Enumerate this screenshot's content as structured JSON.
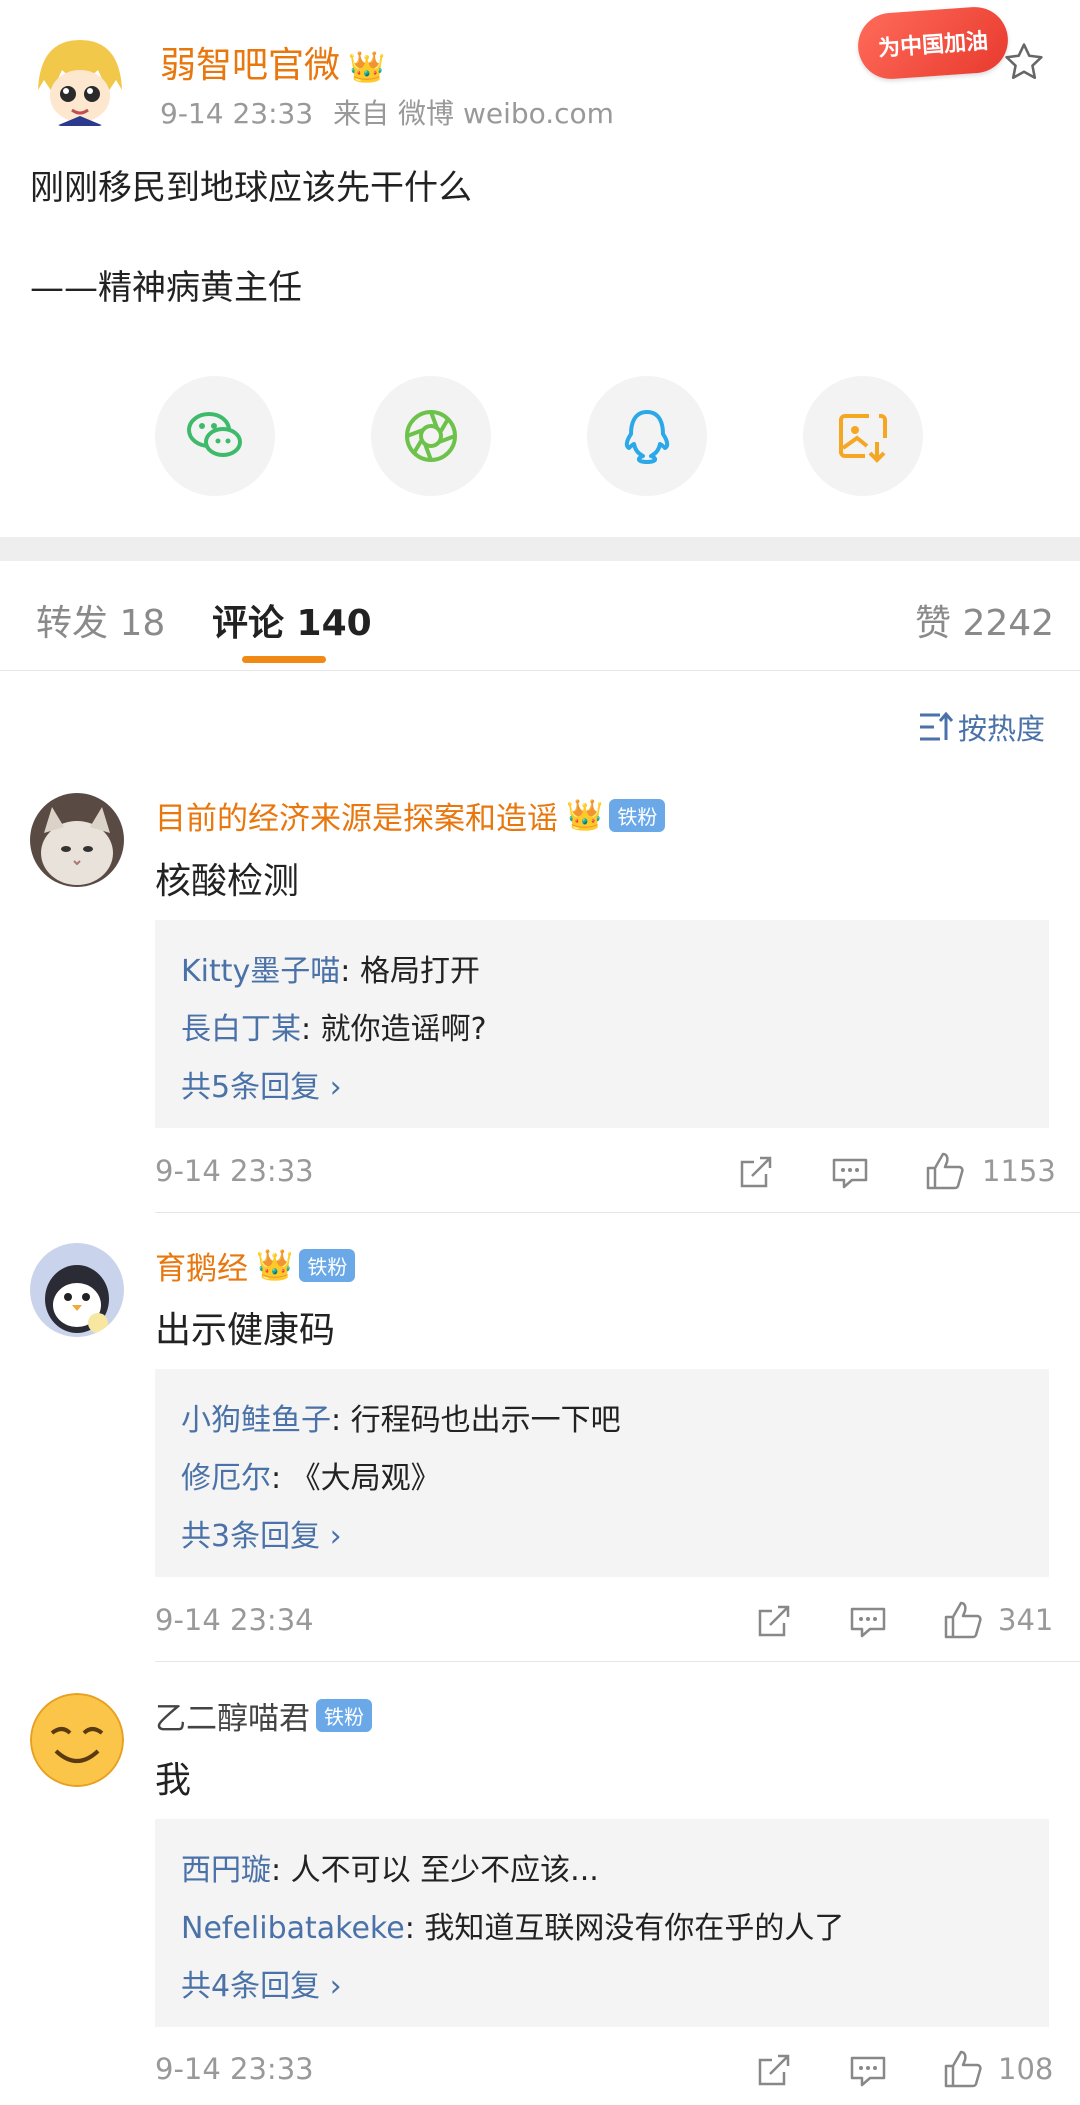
{
  "post": {
    "author": "弱智吧官微",
    "time": "9-14 23:33",
    "source": "来自 微博 weibo.com",
    "badge": "为中国加油",
    "line1": "刚刚移民到地球应该先干什么",
    "line2": "——精神病黄主任"
  },
  "share": [
    "wechat-icon",
    "moments-icon",
    "qq-icon",
    "save-image-icon"
  ],
  "tabs": {
    "repost": "转发 18",
    "comment": "评论 140",
    "like": "赞 2242"
  },
  "sort_label": "按热度",
  "fan_label": "铁粉",
  "comments": [
    {
      "name": "目前的经济来源是探案和造谣",
      "text": "核酸检测",
      "replies": [
        {
          "who": "Kitty墨子喵",
          "text": ": 格局打开"
        },
        {
          "who": "長白丁某",
          "text": ": 就你造谣啊?"
        }
      ],
      "more": "共5条回复",
      "time": "9-14 23:33",
      "likes": "1153"
    },
    {
      "name": "育鹅经",
      "text": "出示健康码",
      "replies": [
        {
          "who": "小狗鲑鱼子",
          "text": ": 行程码也出示一下吧"
        },
        {
          "who": "修厄尔",
          "text": ": 《大局观》"
        }
      ],
      "more": "共3条回复",
      "time": "9-14 23:34",
      "likes": "341"
    },
    {
      "name": "乙二醇喵君",
      "text": "我",
      "replies": [
        {
          "who": "西円璇",
          "text": ": 人不可以 至少不应该..."
        },
        {
          "who": "Nefelibatakeke",
          "text": ": 我知道互联网没有你在乎的人了"
        }
      ],
      "more": "共4条回复",
      "time": "9-14 23:33",
      "likes": "108"
    }
  ],
  "colors": {
    "accent": "#e8770e",
    "link": "#4a72a8",
    "tab_indicator": "#f08a14",
    "fan_badge": "#6aa8e8"
  }
}
